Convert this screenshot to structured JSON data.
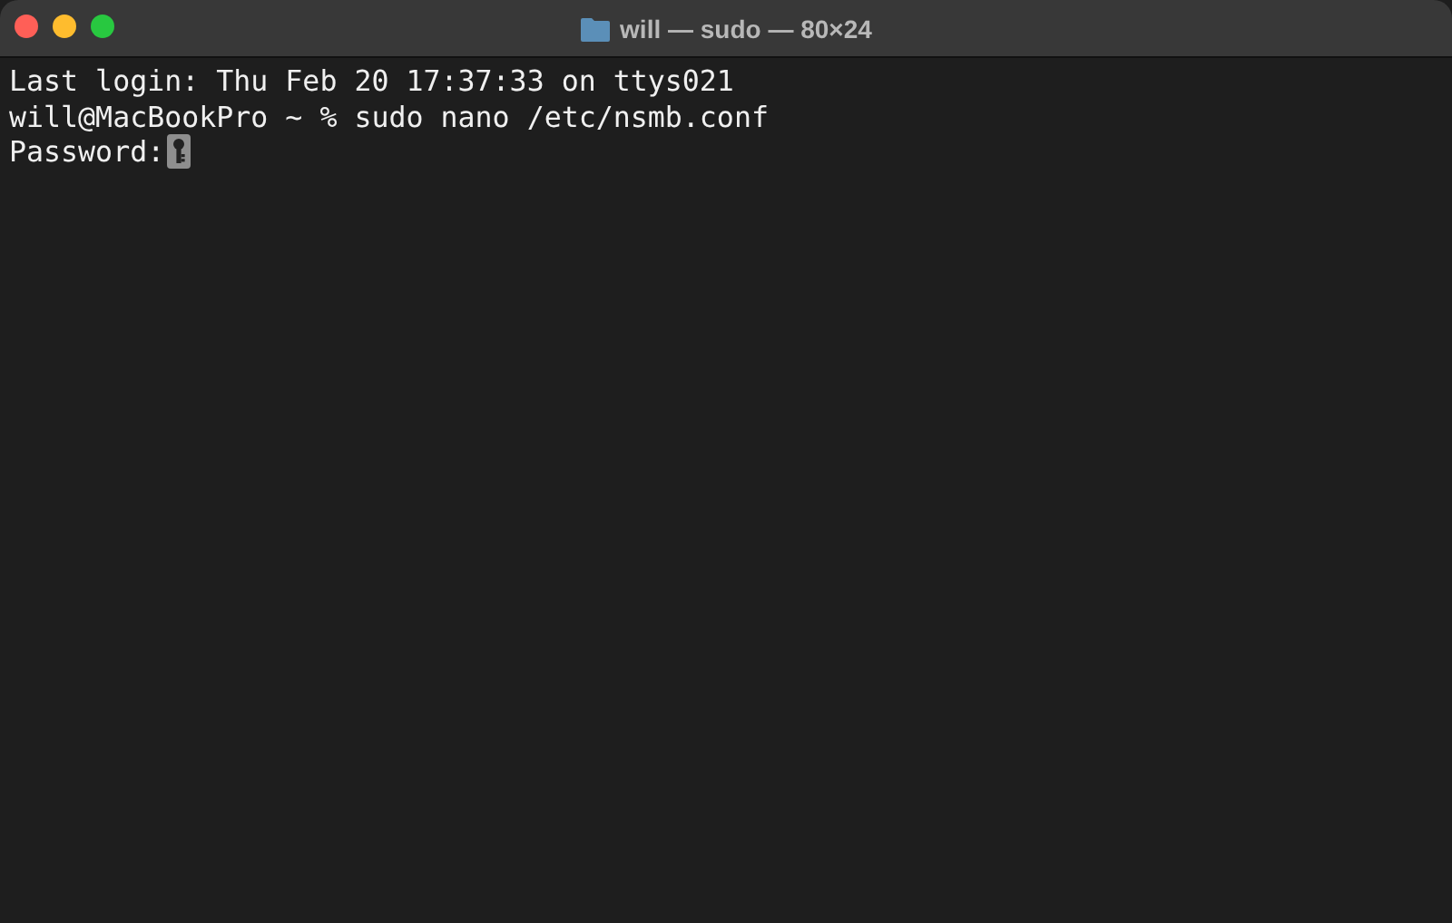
{
  "window": {
    "title": "will — sudo — 80×24"
  },
  "terminal": {
    "lines": [
      {
        "kind": "output",
        "text": "Last login: Thu Feb 20 17:37:33 on ttys021"
      },
      {
        "kind": "prompt",
        "text": "will@MacBookPro ~ % sudo nano /etc/nsmb.conf"
      },
      {
        "kind": "password",
        "text": "Password:"
      }
    ]
  }
}
